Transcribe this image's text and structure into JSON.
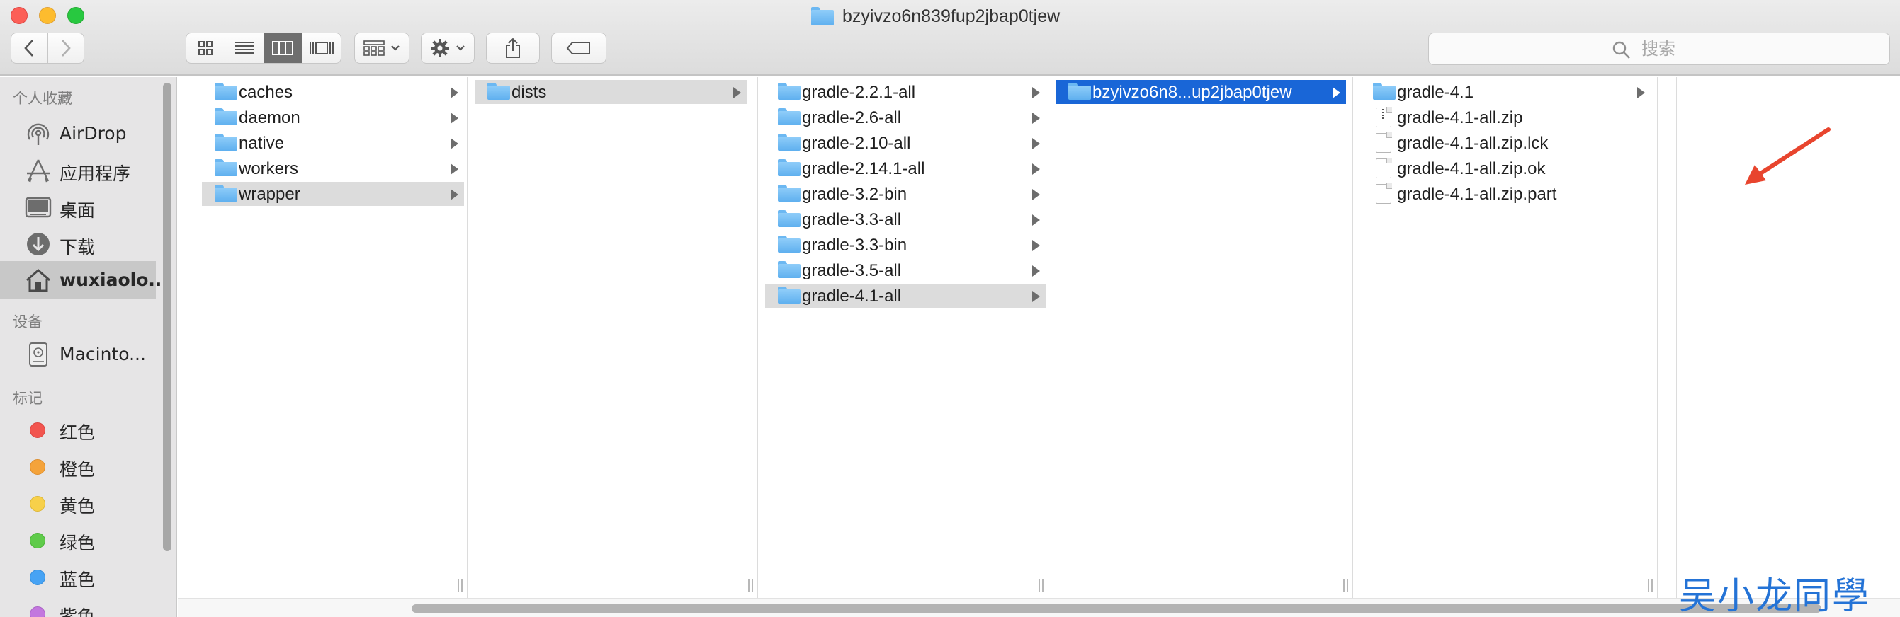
{
  "window": {
    "title": "bzyivzo6n839fup2jbap0tjew"
  },
  "toolbar": {
    "search_placeholder": "搜索"
  },
  "sidebar": {
    "favorites_heading": "个人收藏",
    "favorites": [
      {
        "label": "AirDrop",
        "icon": "airdrop-icon"
      },
      {
        "label": "应用程序",
        "icon": "applications-icon"
      },
      {
        "label": "桌面",
        "icon": "desktop-icon"
      },
      {
        "label": "下载",
        "icon": "downloads-icon"
      },
      {
        "label": "wuxiaolo...",
        "icon": "home-icon",
        "selected": true
      }
    ],
    "devices_heading": "设备",
    "devices": [
      {
        "label": "Macinto...",
        "icon": "hard-drive-icon"
      }
    ],
    "tags_heading": "标记",
    "tags": [
      {
        "label": "红色",
        "color": "#f2554f"
      },
      {
        "label": "橙色",
        "color": "#f4a33b"
      },
      {
        "label": "黄色",
        "color": "#f7d04a"
      },
      {
        "label": "绿色",
        "color": "#5fcb4a"
      },
      {
        "label": "蓝色",
        "color": "#47a3f4"
      },
      {
        "label": "紫色",
        "color": "#c377de"
      }
    ]
  },
  "columns": [
    {
      "items": [
        {
          "label": "caches",
          "kind": "folder"
        },
        {
          "label": "daemon",
          "kind": "folder"
        },
        {
          "label": "native",
          "kind": "folder"
        },
        {
          "label": "workers",
          "kind": "folder"
        },
        {
          "label": "wrapper",
          "kind": "folder",
          "selected": "gray"
        }
      ]
    },
    {
      "items": [
        {
          "label": "dists",
          "kind": "folder",
          "selected": "gray"
        }
      ]
    },
    {
      "items": [
        {
          "label": "gradle-2.2.1-all",
          "kind": "folder"
        },
        {
          "label": "gradle-2.6-all",
          "kind": "folder"
        },
        {
          "label": "gradle-2.10-all",
          "kind": "folder"
        },
        {
          "label": "gradle-2.14.1-all",
          "kind": "folder"
        },
        {
          "label": "gradle-3.2-bin",
          "kind": "folder"
        },
        {
          "label": "gradle-3.3-all",
          "kind": "folder"
        },
        {
          "label": "gradle-3.3-bin",
          "kind": "folder"
        },
        {
          "label": "gradle-3.5-all",
          "kind": "folder"
        },
        {
          "label": "gradle-4.1-all",
          "kind": "folder",
          "selected": "gray"
        }
      ]
    },
    {
      "items": [
        {
          "label": "bzyivzo6n8...up2jbap0tjew",
          "kind": "folder",
          "selected": "blue"
        }
      ]
    },
    {
      "items": [
        {
          "label": "gradle-4.1",
          "kind": "folder"
        },
        {
          "label": "gradle-4.1-all.zip",
          "kind": "zip"
        },
        {
          "label": "gradle-4.1-all.zip.lck",
          "kind": "file"
        },
        {
          "label": "gradle-4.1-all.zip.ok",
          "kind": "file"
        },
        {
          "label": "gradle-4.1-all.zip.part",
          "kind": "file"
        }
      ]
    }
  ],
  "annotation": {
    "arrow_color": "#e8452e"
  },
  "watermark": {
    "text": "吴小龙同學"
  }
}
